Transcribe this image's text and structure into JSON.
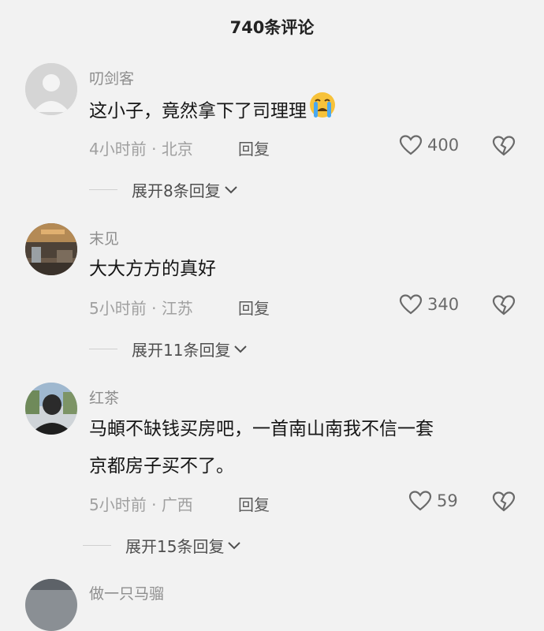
{
  "header": {
    "title": "740条评论"
  },
  "comments": [
    {
      "user": "叨剑客",
      "text_line1": "这小子，竟然拿下了司理理",
      "time": "4小时前",
      "location": "北京",
      "reply_label": "回复",
      "likes": "400",
      "expand_label": "展开8条回复",
      "emoji_icon": "crying-face-icon"
    },
    {
      "user": "末见",
      "text_line1": "大大方方的真好",
      "time": "5小时前",
      "location": "江苏",
      "reply_label": "回复",
      "likes": "340",
      "expand_label": "展开11条回复"
    },
    {
      "user": "红茶",
      "text_line1": "马頔不缺钱买房吧，一首南山南我不信一套",
      "text_line2": "京都房子买不了。",
      "time": "5小时前",
      "location": "广西",
      "reply_label": "回复",
      "likes": "59",
      "expand_label": "展开15条回复"
    },
    {
      "user": "做一只马骝"
    }
  ],
  "meta_separator": "·",
  "colors": {
    "background": "#f2f2f2",
    "muted_text": "#8e8e8e",
    "emoji_yellow": "#f7c23a",
    "tear_blue": "#4aa8f0"
  }
}
